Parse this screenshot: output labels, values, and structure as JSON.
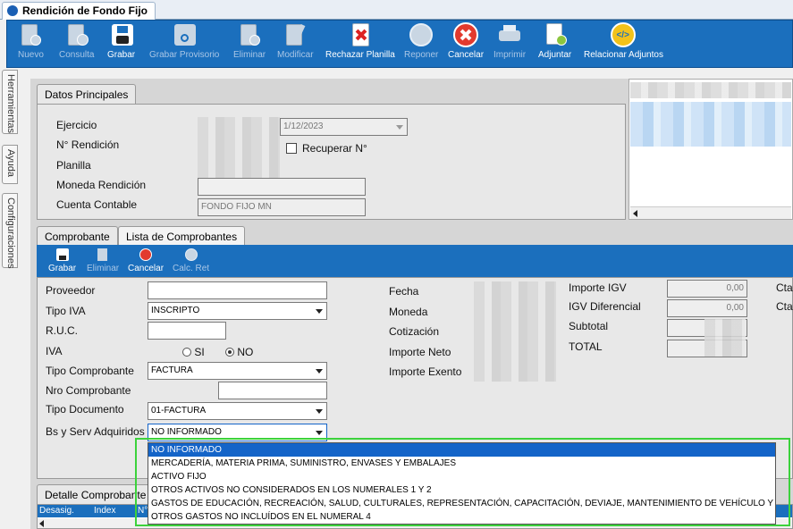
{
  "window": {
    "tab_title": "Rendición de Fondo Fijo"
  },
  "toolbar": [
    {
      "label": "Nuevo",
      "icon": "new-document-icon",
      "enabled": false
    },
    {
      "label": "Consulta",
      "icon": "query-document-icon",
      "enabled": false
    },
    {
      "label": "Grabar",
      "icon": "save-icon",
      "enabled": true
    },
    {
      "label": "Grabar Provisorio",
      "icon": "save-draft-icon",
      "enabled": false
    },
    {
      "label": "Eliminar",
      "icon": "delete-document-icon",
      "enabled": false
    },
    {
      "label": "Modificar",
      "icon": "edit-document-icon",
      "enabled": false
    },
    {
      "label": "Rechazar Planilla",
      "icon": "reject-sheet-icon",
      "enabled": true
    },
    {
      "label": "Reponer",
      "icon": "replenish-icon",
      "enabled": false
    },
    {
      "label": "Cancelar",
      "icon": "cancel-icon",
      "enabled": true
    },
    {
      "label": "Imprimir",
      "icon": "printer-icon",
      "enabled": false
    },
    {
      "label": "Adjuntar",
      "icon": "attach-icon",
      "enabled": true
    },
    {
      "label": "Relacionar Adjuntos",
      "icon": "link-attachments-icon",
      "enabled": true
    }
  ],
  "side_tabs": [
    "Herramientas",
    "Ayuda",
    "Configuraciones"
  ],
  "datos": {
    "tab": "Datos Principales",
    "ejercicio_label": "Ejercicio",
    "rendicion_label": "N° Rendición",
    "planilla_label": "Planilla",
    "moneda_label": "Moneda Rendición",
    "cuenta_label": "Cuenta Contable",
    "date_value": "1/12/2023",
    "recuperar_label": "Recuperar N°",
    "cuenta_value": "FONDO FIJO MN"
  },
  "comprobante_tabs": [
    "Comprobante",
    "Lista de Comprobantes"
  ],
  "sub_toolbar": [
    {
      "label": "Grabar",
      "icon": "save-icon",
      "enabled": true
    },
    {
      "label": "Eliminar",
      "icon": "delete-icon",
      "enabled": false
    },
    {
      "label": "Cancelar",
      "icon": "cancel-icon",
      "enabled": true
    },
    {
      "label": "Calc. Ret",
      "icon": "calculate-icon",
      "enabled": false
    }
  ],
  "form": {
    "proveedor_label": "Proveedor",
    "tipo_iva_label": "Tipo IVA",
    "tipo_iva_value": "INSCRIPTO",
    "ruc_label": "R.U.C.",
    "iva_label": "IVA",
    "iva_si": "SI",
    "iva_no": "NO",
    "tipo_comp_label": "Tipo Comprobante",
    "tipo_comp_value": "FACTURA",
    "nro_comp_label": "Nro Comprobante",
    "tipo_doc_label": "Tipo Documento",
    "tipo_doc_value": "01-FACTURA",
    "bs_label": "Bs y Serv Adquiridos",
    "bs_value": "NO INFORMADO",
    "fecha_label": "Fecha",
    "moneda_label": "Moneda",
    "cotizacion_label": "Cotización",
    "importe_neto_label": "Importe Neto",
    "importe_exento_label": "Importe Exento",
    "importe_igv_label": "Importe IGV",
    "importe_igv_value": "0,00",
    "igv_dif_label": "IGV Diferencial",
    "igv_dif_value": "0,00",
    "subtotal_label": "Subtotal",
    "total_label": "TOTAL",
    "cta1": "Cta",
    "cta2": "Cta"
  },
  "detalle": {
    "tab": "Detalle Comprobante",
    "cols": [
      "Desasig.",
      "Index",
      "N°"
    ]
  },
  "dropdown_options": [
    "NO INFORMADO",
    "MERCADERÍA, MATERIA PRIMA, SUMINISTRO, ENVASES Y EMBALAJES",
    "ACTIVO FIJO",
    "OTROS ACTIVOS NO CONSIDERADOS EN LOS NUMERALES 1 Y 2",
    "GASTOS DE EDUCACIÓN, RECREACIÓN, SALUD, CULTURALES, REPRESENTACIÓN, CAPACITACIÓN, DEVIAJE, MANTENIMIENTO DE VEHÍCULO Y DE PREMIOS",
    "OTROS GASTOS NO INCLUÍDOS EN EL NUMERAL 4"
  ],
  "colors": {
    "toolbar_blue": "#1b6fbd",
    "selection_blue": "#1464c8",
    "highlight_green": "#3cd23c"
  }
}
